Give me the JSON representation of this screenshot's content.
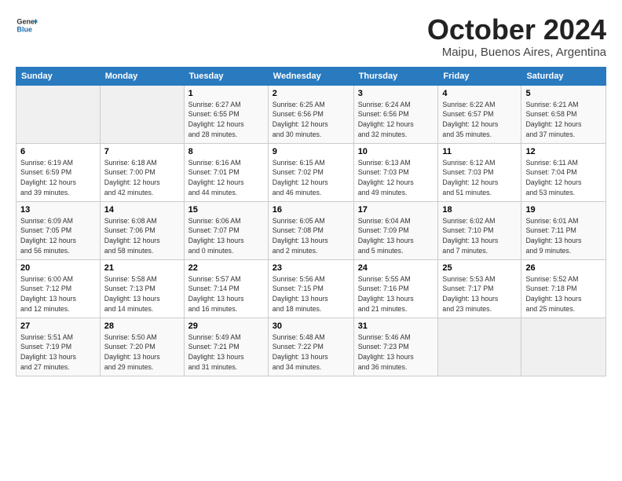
{
  "header": {
    "logo_general": "General",
    "logo_blue": "Blue",
    "month": "October 2024",
    "location": "Maipu, Buenos Aires, Argentina"
  },
  "days_of_week": [
    "Sunday",
    "Monday",
    "Tuesday",
    "Wednesday",
    "Thursday",
    "Friday",
    "Saturday"
  ],
  "weeks": [
    [
      {
        "day": "",
        "detail": ""
      },
      {
        "day": "",
        "detail": ""
      },
      {
        "day": "1",
        "detail": "Sunrise: 6:27 AM\nSunset: 6:55 PM\nDaylight: 12 hours\nand 28 minutes."
      },
      {
        "day": "2",
        "detail": "Sunrise: 6:25 AM\nSunset: 6:56 PM\nDaylight: 12 hours\nand 30 minutes."
      },
      {
        "day": "3",
        "detail": "Sunrise: 6:24 AM\nSunset: 6:56 PM\nDaylight: 12 hours\nand 32 minutes."
      },
      {
        "day": "4",
        "detail": "Sunrise: 6:22 AM\nSunset: 6:57 PM\nDaylight: 12 hours\nand 35 minutes."
      },
      {
        "day": "5",
        "detail": "Sunrise: 6:21 AM\nSunset: 6:58 PM\nDaylight: 12 hours\nand 37 minutes."
      }
    ],
    [
      {
        "day": "6",
        "detail": "Sunrise: 6:19 AM\nSunset: 6:59 PM\nDaylight: 12 hours\nand 39 minutes."
      },
      {
        "day": "7",
        "detail": "Sunrise: 6:18 AM\nSunset: 7:00 PM\nDaylight: 12 hours\nand 42 minutes."
      },
      {
        "day": "8",
        "detail": "Sunrise: 6:16 AM\nSunset: 7:01 PM\nDaylight: 12 hours\nand 44 minutes."
      },
      {
        "day": "9",
        "detail": "Sunrise: 6:15 AM\nSunset: 7:02 PM\nDaylight: 12 hours\nand 46 minutes."
      },
      {
        "day": "10",
        "detail": "Sunrise: 6:13 AM\nSunset: 7:03 PM\nDaylight: 12 hours\nand 49 minutes."
      },
      {
        "day": "11",
        "detail": "Sunrise: 6:12 AM\nSunset: 7:03 PM\nDaylight: 12 hours\nand 51 minutes."
      },
      {
        "day": "12",
        "detail": "Sunrise: 6:11 AM\nSunset: 7:04 PM\nDaylight: 12 hours\nand 53 minutes."
      }
    ],
    [
      {
        "day": "13",
        "detail": "Sunrise: 6:09 AM\nSunset: 7:05 PM\nDaylight: 12 hours\nand 56 minutes."
      },
      {
        "day": "14",
        "detail": "Sunrise: 6:08 AM\nSunset: 7:06 PM\nDaylight: 12 hours\nand 58 minutes."
      },
      {
        "day": "15",
        "detail": "Sunrise: 6:06 AM\nSunset: 7:07 PM\nDaylight: 13 hours\nand 0 minutes."
      },
      {
        "day": "16",
        "detail": "Sunrise: 6:05 AM\nSunset: 7:08 PM\nDaylight: 13 hours\nand 2 minutes."
      },
      {
        "day": "17",
        "detail": "Sunrise: 6:04 AM\nSunset: 7:09 PM\nDaylight: 13 hours\nand 5 minutes."
      },
      {
        "day": "18",
        "detail": "Sunrise: 6:02 AM\nSunset: 7:10 PM\nDaylight: 13 hours\nand 7 minutes."
      },
      {
        "day": "19",
        "detail": "Sunrise: 6:01 AM\nSunset: 7:11 PM\nDaylight: 13 hours\nand 9 minutes."
      }
    ],
    [
      {
        "day": "20",
        "detail": "Sunrise: 6:00 AM\nSunset: 7:12 PM\nDaylight: 13 hours\nand 12 minutes."
      },
      {
        "day": "21",
        "detail": "Sunrise: 5:58 AM\nSunset: 7:13 PM\nDaylight: 13 hours\nand 14 minutes."
      },
      {
        "day": "22",
        "detail": "Sunrise: 5:57 AM\nSunset: 7:14 PM\nDaylight: 13 hours\nand 16 minutes."
      },
      {
        "day": "23",
        "detail": "Sunrise: 5:56 AM\nSunset: 7:15 PM\nDaylight: 13 hours\nand 18 minutes."
      },
      {
        "day": "24",
        "detail": "Sunrise: 5:55 AM\nSunset: 7:16 PM\nDaylight: 13 hours\nand 21 minutes."
      },
      {
        "day": "25",
        "detail": "Sunrise: 5:53 AM\nSunset: 7:17 PM\nDaylight: 13 hours\nand 23 minutes."
      },
      {
        "day": "26",
        "detail": "Sunrise: 5:52 AM\nSunset: 7:18 PM\nDaylight: 13 hours\nand 25 minutes."
      }
    ],
    [
      {
        "day": "27",
        "detail": "Sunrise: 5:51 AM\nSunset: 7:19 PM\nDaylight: 13 hours\nand 27 minutes."
      },
      {
        "day": "28",
        "detail": "Sunrise: 5:50 AM\nSunset: 7:20 PM\nDaylight: 13 hours\nand 29 minutes."
      },
      {
        "day": "29",
        "detail": "Sunrise: 5:49 AM\nSunset: 7:21 PM\nDaylight: 13 hours\nand 31 minutes."
      },
      {
        "day": "30",
        "detail": "Sunrise: 5:48 AM\nSunset: 7:22 PM\nDaylight: 13 hours\nand 34 minutes."
      },
      {
        "day": "31",
        "detail": "Sunrise: 5:46 AM\nSunset: 7:23 PM\nDaylight: 13 hours\nand 36 minutes."
      },
      {
        "day": "",
        "detail": ""
      },
      {
        "day": "",
        "detail": ""
      }
    ]
  ]
}
